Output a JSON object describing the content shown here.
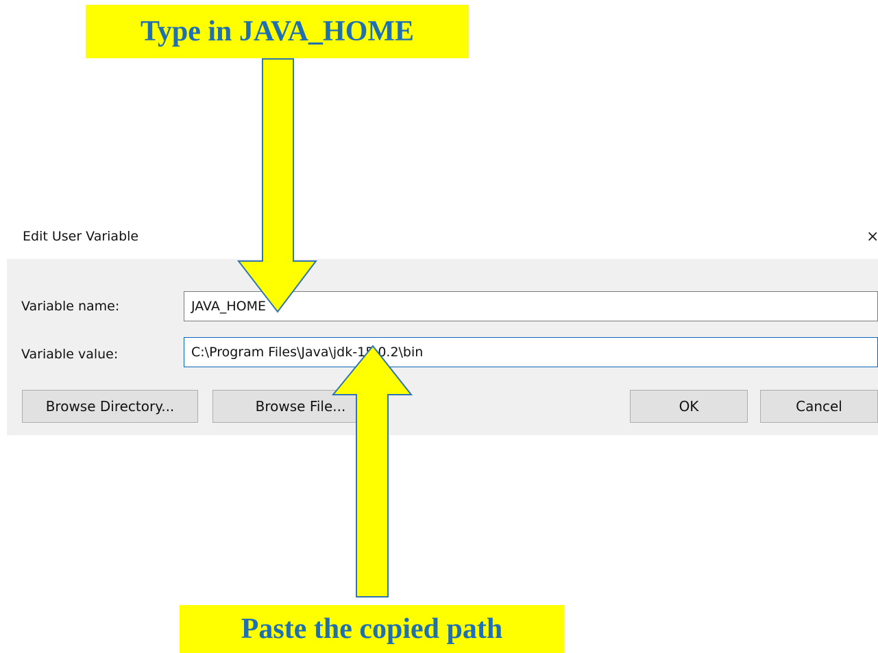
{
  "callouts": {
    "top_text": "Type in JAVA_HOME",
    "bottom_text": "Paste the copied path"
  },
  "dialog": {
    "title": "Edit User Variable",
    "close_glyph": "×",
    "variable_name_label": "Variable name:",
    "variable_name_value": "JAVA_HOME",
    "variable_value_label": "Variable value:",
    "variable_value_value": "C:\\Program Files\\Java\\jdk-15.0.2\\bin",
    "buttons": {
      "browse_directory": "Browse Directory...",
      "browse_file": "Browse File...",
      "ok": "OK",
      "cancel": "Cancel"
    }
  },
  "colors": {
    "callout_bg": "#ffff00",
    "callout_text": "#1f6fb3",
    "arrow_fill": "#ffff00",
    "arrow_stroke": "#2f74b5",
    "dialog_bg": "#f0f0f0"
  },
  "icons": {
    "close": "close-icon",
    "arrow_down": "arrow-down-icon",
    "arrow_up": "arrow-up-icon"
  }
}
